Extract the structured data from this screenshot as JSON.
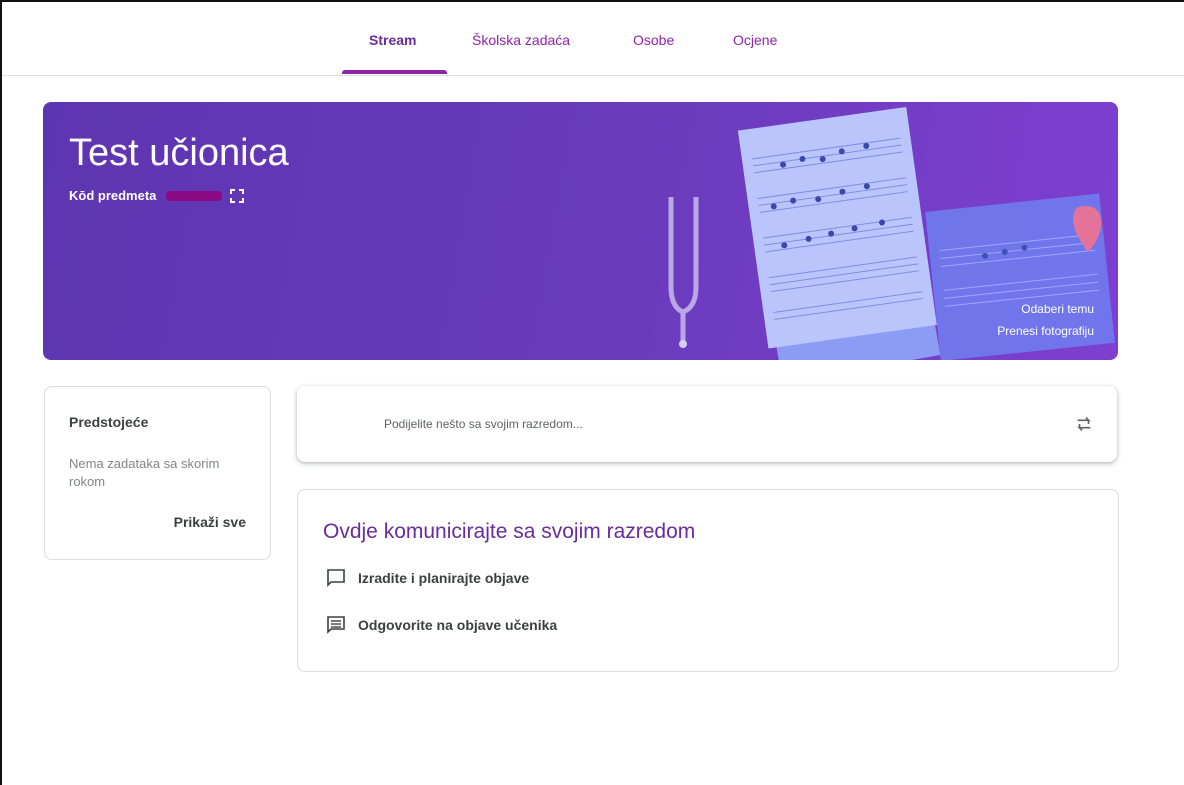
{
  "nav": {
    "tabs": [
      {
        "label": "Stream",
        "active": true
      },
      {
        "label": "Školska zadaća",
        "active": false
      },
      {
        "label": "Osobe",
        "active": false
      },
      {
        "label": "Ocjene",
        "active": false
      }
    ]
  },
  "banner": {
    "title": "Test učionica",
    "class_code_label": "Kōd predmeta",
    "choose_theme": "Odaberi temu",
    "upload_photo": "Prenesi fotografiju",
    "theme_colors": {
      "start": "#5e35b1",
      "end": "#7e3fd0"
    }
  },
  "upcoming": {
    "title": "Predstojeće",
    "empty_text": "Nema zadataka sa skorim rokom",
    "view_all": "Prikaži sve"
  },
  "share": {
    "placeholder": "Podijelite nešto sa svojim razredom...",
    "icon": "repost-icon"
  },
  "info": {
    "title": "Ovdje komunicirajte sa svojim razredom",
    "items": [
      {
        "icon": "announcement-icon",
        "label": "Izradite i planirajte objave"
      },
      {
        "icon": "comment-icon",
        "label": "Odgovorite na objave učenika"
      }
    ]
  },
  "colors": {
    "accent": "#8e24aa",
    "title_purple": "#6a2c9a"
  }
}
